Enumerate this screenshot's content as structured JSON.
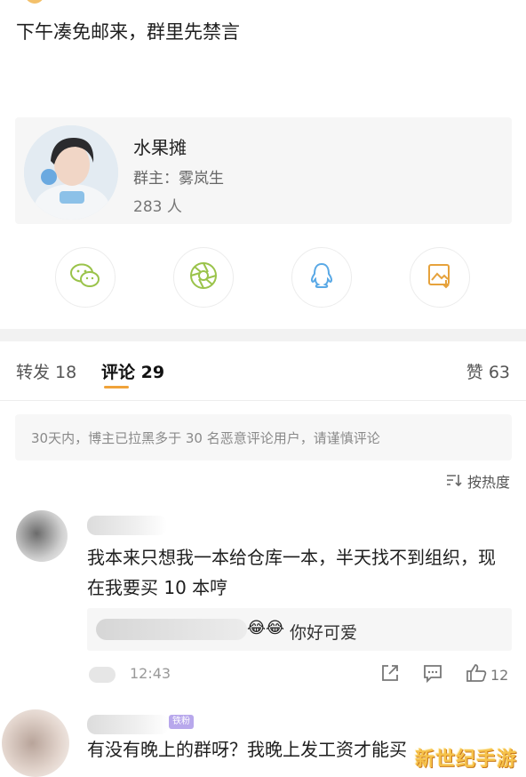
{
  "post": {
    "text": "下午凑免邮来，群里先禁言"
  },
  "group_card": {
    "name": "水果摊",
    "owner": "群主：雾岚生",
    "members": "283 人"
  },
  "share": [
    {
      "icon": "wechat-icon"
    },
    {
      "icon": "moments-icon"
    },
    {
      "icon": "qq-icon"
    },
    {
      "icon": "save-image-icon"
    }
  ],
  "tabs": {
    "repost": "转发 18",
    "comments": "评论 29",
    "likes": "赞 63"
  },
  "notice": "30天内，博主已拉黑多于 30 名恶意评论用户，请谨慎评论",
  "sort_label": "按热度",
  "comments": [
    {
      "text": "我本来只想我一本给仓库一本，半天找不到组织，现在我要买 10 本哼",
      "reply": {
        "emoji": "😂😂",
        "text": "你好可爱"
      },
      "time": "12:43",
      "like_count": "12"
    },
    {
      "text": "有没有晚上的群呀？我晚上发工资才能买",
      "badge": "铁粉"
    }
  ],
  "watermark": "新世纪手游",
  "colors": {
    "accent": "#f0a33a",
    "badge": "#b8a8ec"
  }
}
